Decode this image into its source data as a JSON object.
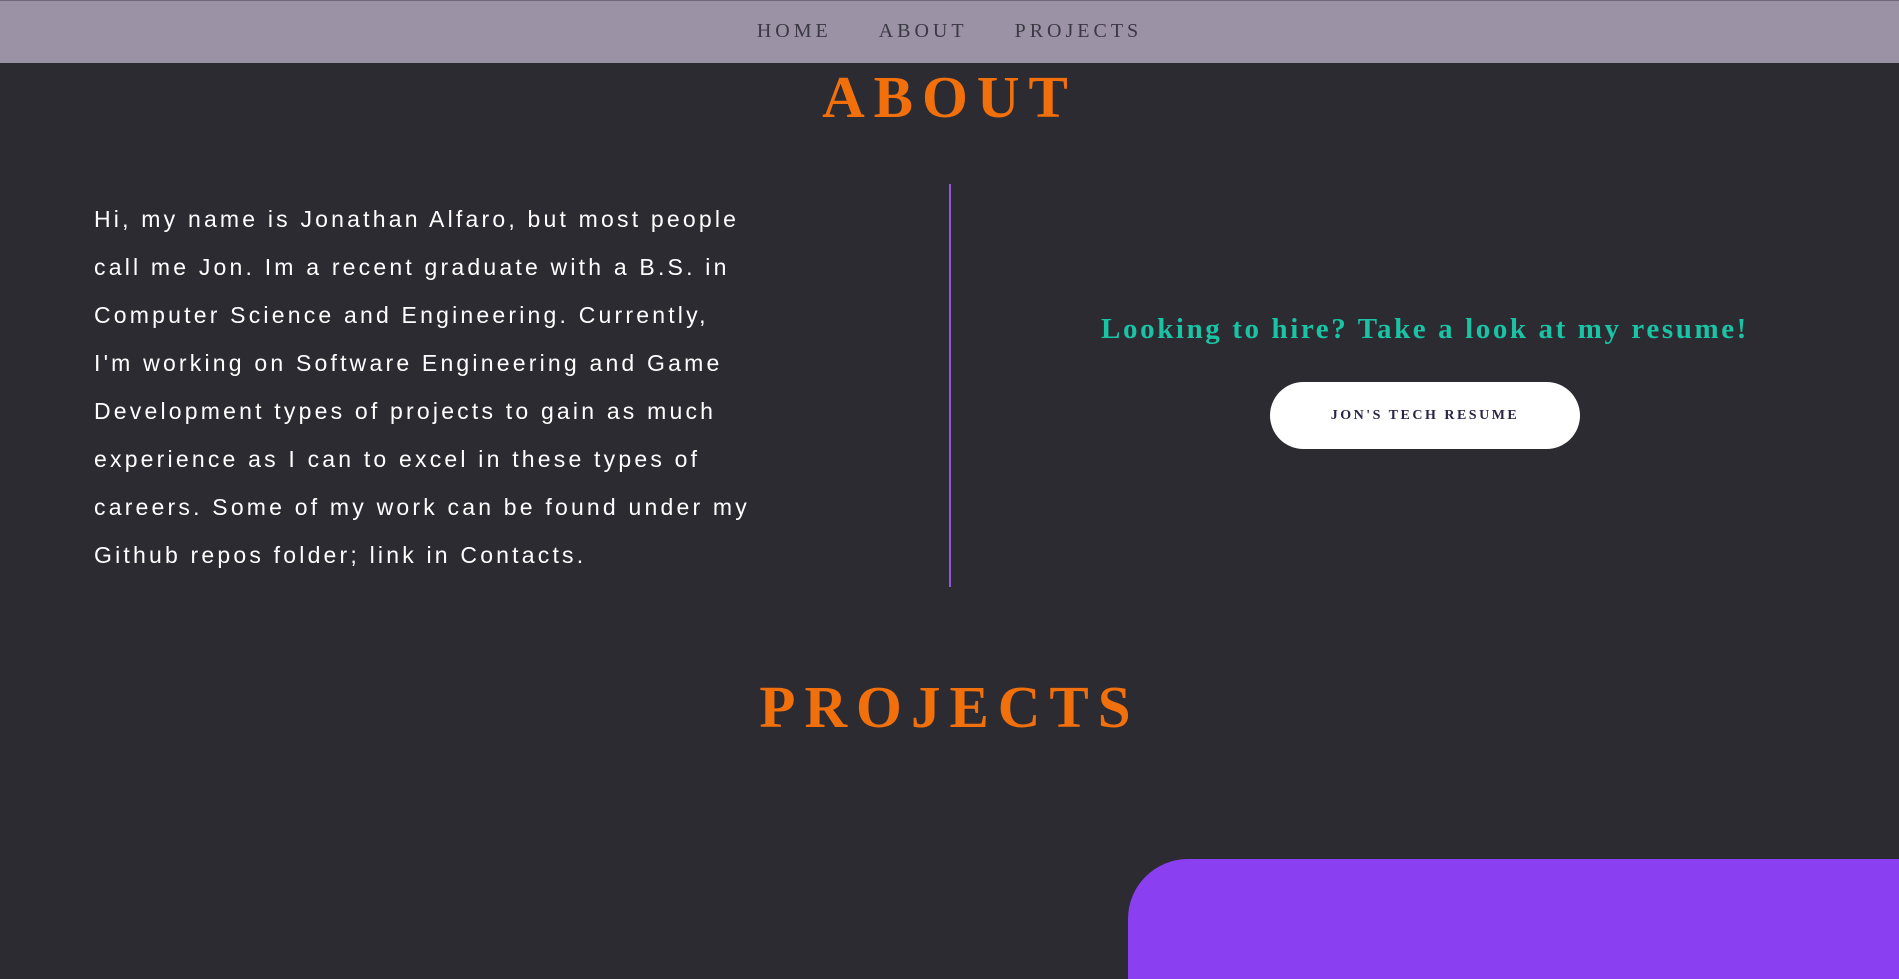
{
  "nav": {
    "items": [
      {
        "label": "HOME"
      },
      {
        "label": "ABOUT"
      },
      {
        "label": "PROJECTS"
      }
    ]
  },
  "about": {
    "title": "ABOUT",
    "lines": [
      "Hi, my name is Jonathan Alfaro, but most people",
      "call me Jon. Im a recent graduate with a B.S. in",
      "Computer Science and Engineering. Currently,",
      "I'm working on Software Engineering and Game",
      "Development types of projects to gain as much",
      "experience as I can to excel in these types of",
      "careers. Some of my work can be found under my",
      "Github repos folder; link in Contacts."
    ],
    "hire_text": "Looking to hire? Take a look at my resume!",
    "resume_button": "JON'S TECH RESUME"
  },
  "projects": {
    "title": "PROJECTS"
  },
  "colors": {
    "background": "#2c2b32",
    "navbar": "#9b93a5",
    "accent_orange": "#f2700c",
    "accent_teal": "#19c3a3",
    "accent_purple": "#8a3ff0"
  }
}
